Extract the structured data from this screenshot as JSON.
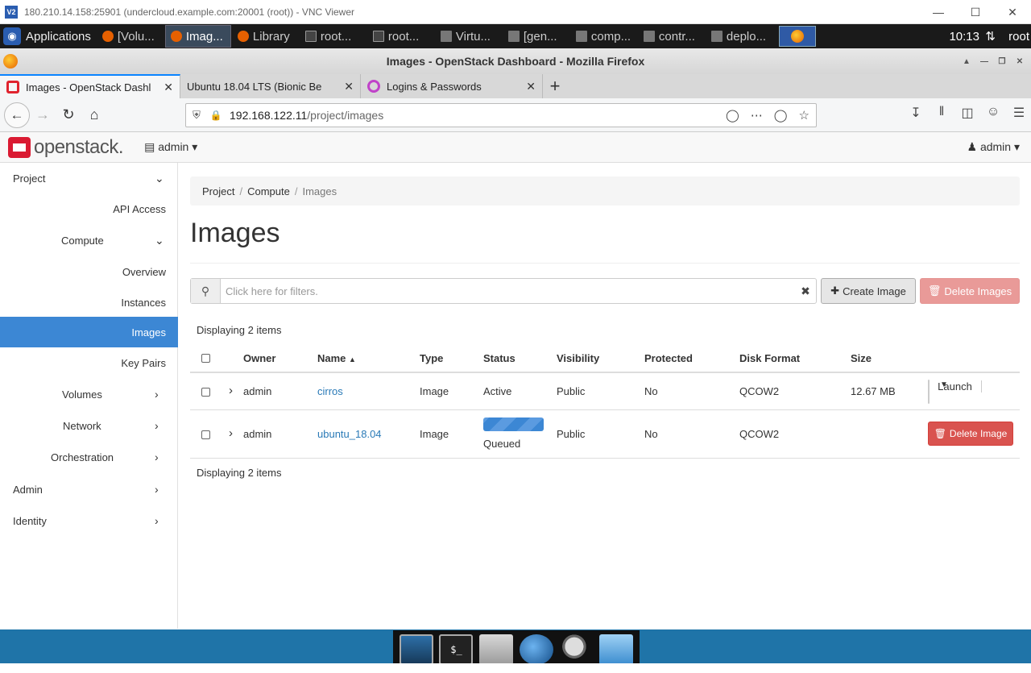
{
  "vnc": {
    "title": "180.210.14.158:25901 (undercloud.example.com:20001 (root)) - VNC Viewer",
    "icon": "V2"
  },
  "panel": {
    "applications": "Applications",
    "tasks": [
      "[Volu...",
      "Imag...",
      "Library",
      "root...",
      "root...",
      "Virtu...",
      "[gen...",
      "comp...",
      "contr...",
      "deplo..."
    ],
    "clock": "10:13",
    "user": "root"
  },
  "firefox": {
    "window_title": "Images - OpenStack Dashboard - Mozilla Firefox",
    "tabs": [
      {
        "label": "Images - OpenStack Dashl",
        "active": true
      },
      {
        "label": "Ubuntu 18.04 LTS (Bionic Be",
        "active": false
      },
      {
        "label": "Logins & Passwords",
        "active": false
      }
    ],
    "url_host": "192.168.122.11",
    "url_path": "/project/images"
  },
  "header": {
    "logo": "openstack.",
    "project": "admin",
    "user": "admin"
  },
  "sidebar": {
    "items": [
      {
        "label": "Project"
      },
      {
        "label": "API Access"
      },
      {
        "label": "Compute"
      },
      {
        "label": "Overview"
      },
      {
        "label": "Instances"
      },
      {
        "label": "Images"
      },
      {
        "label": "Key Pairs"
      },
      {
        "label": "Volumes"
      },
      {
        "label": "Network"
      },
      {
        "label": "Orchestration"
      },
      {
        "label": "Admin"
      },
      {
        "label": "Identity"
      }
    ]
  },
  "breadcrumb": [
    "Project",
    "Compute",
    "Images"
  ],
  "page_title": "Images",
  "filter": {
    "placeholder": "Click here for filters."
  },
  "actions": {
    "create": "Create Image",
    "delete_all": "Delete Images"
  },
  "display_count": "Displaying 2 items",
  "table": {
    "headers": [
      "Owner",
      "Name",
      "Type",
      "Status",
      "Visibility",
      "Protected",
      "Disk Format",
      "Size"
    ],
    "rows": [
      {
        "owner": "admin",
        "name": "cirros",
        "type": "Image",
        "status": "Active",
        "visibility": "Public",
        "protected": "No",
        "format": "QCOW2",
        "size": "12.67 MB",
        "action": "Launch"
      },
      {
        "owner": "admin",
        "name": "ubuntu_18.04",
        "type": "Image",
        "status": "Queued",
        "visibility": "Public",
        "protected": "No",
        "format": "QCOW2",
        "size": "",
        "action": "Delete Image"
      }
    ]
  }
}
